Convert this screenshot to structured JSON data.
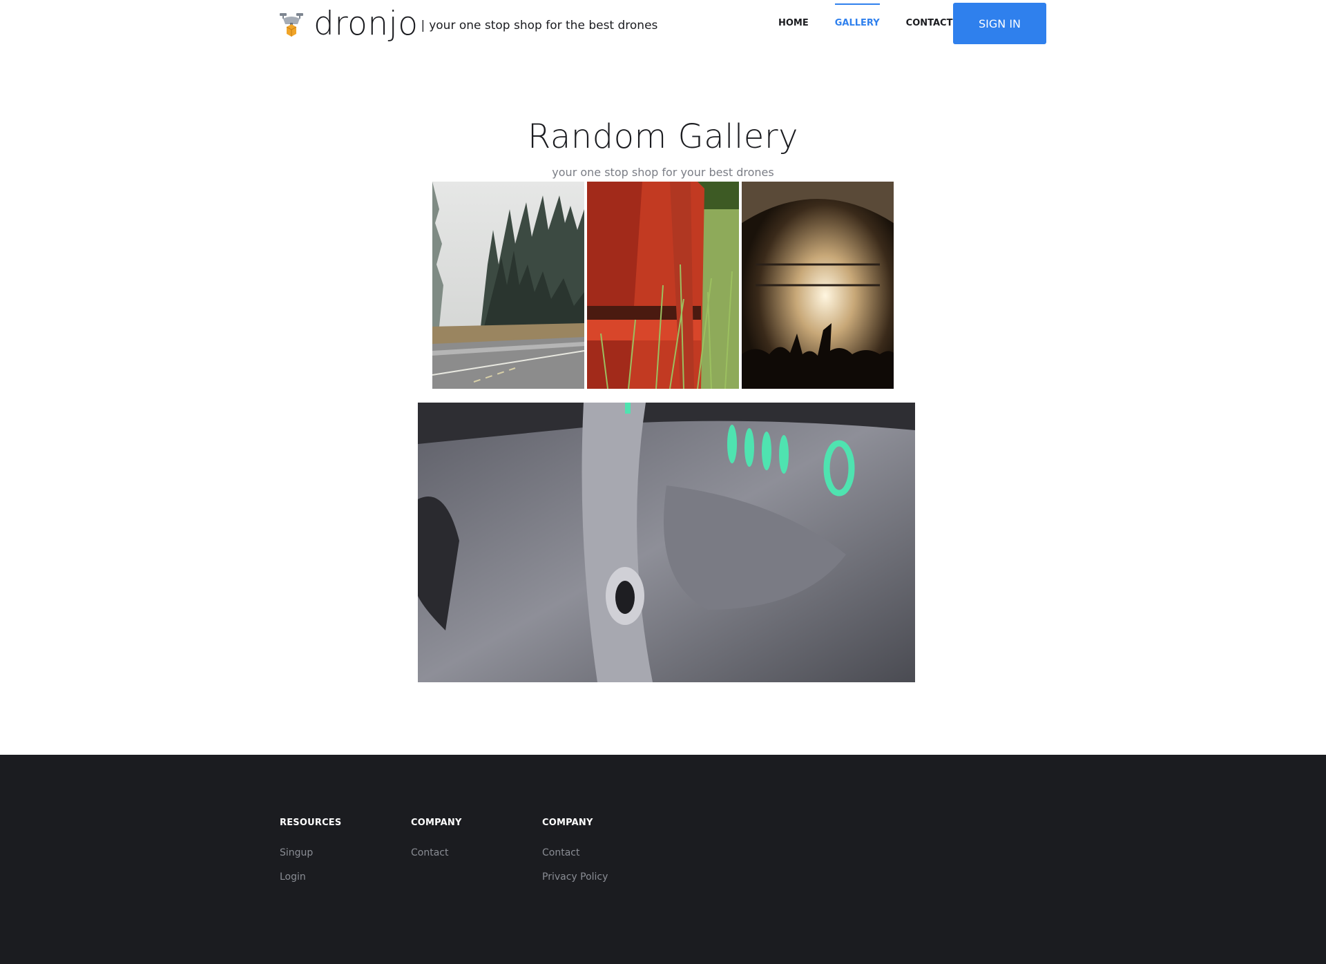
{
  "header": {
    "brand_name": "dronjo",
    "separator": "|",
    "tagline": "your one stop shop for the best drones",
    "logo_icon": "drone-package-icon",
    "nav": [
      {
        "label": "HOME",
        "active": false
      },
      {
        "label": "GALLERY",
        "active": true
      },
      {
        "label": "CONTACT",
        "active": false
      }
    ],
    "signin_label": "SIGN IN",
    "accent_color": "#2f80ed"
  },
  "hero": {
    "title": "Random Gallery",
    "subtitle": "your one stop shop for your best drones"
  },
  "gallery": {
    "images": [
      {
        "name": "forest-road-photo"
      },
      {
        "name": "red-barrel-grass-photo"
      },
      {
        "name": "concert-crowd-photo"
      },
      {
        "name": "drone-closeup-photo"
      }
    ]
  },
  "footer": {
    "background": "#1b1c20",
    "columns": [
      {
        "title": "RESOURCES",
        "links": [
          "Singup",
          "Login"
        ]
      },
      {
        "title": "COMPANY",
        "links": [
          "Contact"
        ]
      },
      {
        "title": "COMPANY",
        "links": [
          "Contact",
          "Privacy Policy"
        ]
      }
    ]
  }
}
